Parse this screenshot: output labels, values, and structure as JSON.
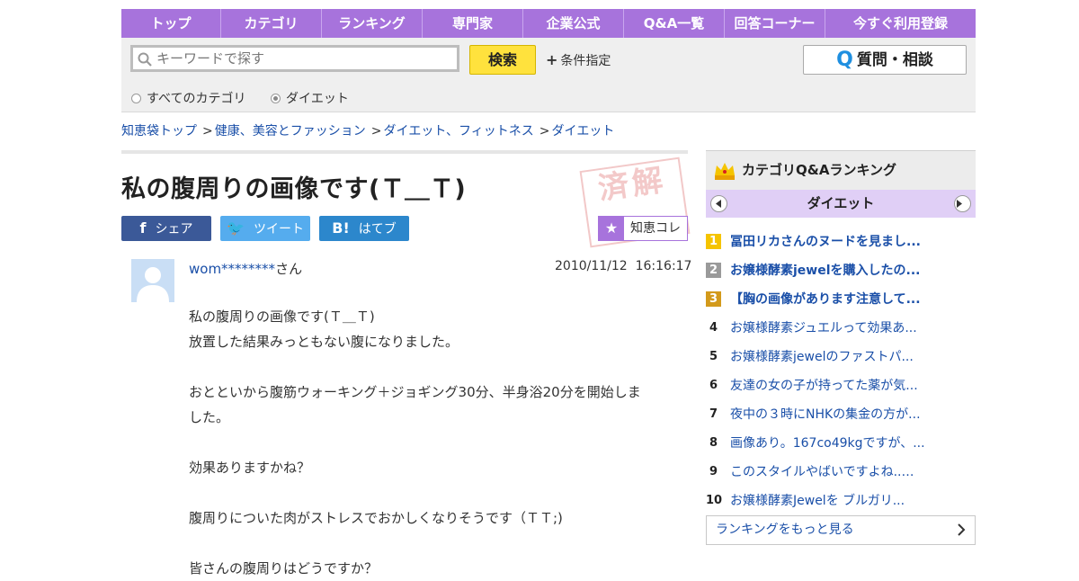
{
  "nav": [
    {
      "label": "トップ",
      "w": 111
    },
    {
      "label": "カテゴリ",
      "w": 112
    },
    {
      "label": "ランキング",
      "w": 112
    },
    {
      "label": "専門家",
      "w": 112
    },
    {
      "label": "企業公式",
      "w": 112
    },
    {
      "label": "Q&A一覧",
      "w": 112
    },
    {
      "label": "回答コーナー",
      "w": 112
    },
    {
      "label": "今すぐ利用登録",
      "w": 167
    }
  ],
  "search": {
    "placeholder": "キーワードで探す",
    "button_label": "検索",
    "condition_label": "条件指定",
    "ask_button_label": "質問・相談",
    "scope_all": "すべてのカテゴリ",
    "scope_current": "ダイエット"
  },
  "breadcrumb": [
    "知恵袋トップ",
    "健康、美容とファッション",
    "ダイエット、フィットネス",
    "ダイエット"
  ],
  "question": {
    "title": "私の腹周りの画像です(Ｔ＿Ｔ)",
    "stamp_text": "済解",
    "user": "wom********",
    "user_suffix": "さん",
    "date": "2010/11/12  16:16:17",
    "body": [
      "私の腹周りの画像です(Ｔ＿Ｔ)",
      "放置した結果みっともない腹になりました。",
      "",
      "おとといから腹筋ウォーキング＋ジョギング30分、半身浴20分を開始しま",
      "した。",
      "",
      "効果ありますかね？",
      "",
      "腹周りについた肉がストレスでおかしくなりそうです（ＴＴ;)",
      "",
      "皆さんの腹周りはどうですか？"
    ]
  },
  "share": {
    "facebook": "シェア",
    "twitter": "ツイート",
    "hatena": "はてブ",
    "chiekore": "知恵コレ"
  },
  "sidebar": {
    "title": "カテゴリQ&Aランキング",
    "category": "ダイエット",
    "ranking": [
      {
        "num": "1",
        "title": "冨田リカさんのヌードを見まし..."
      },
      {
        "num": "2",
        "title": "お嬢様酵素jewelを購入したの..."
      },
      {
        "num": "3",
        "title": "【胸の画像があります注意して..."
      },
      {
        "num": "4",
        "title": "お嬢様酵素ジュエルって効果あ..."
      },
      {
        "num": "5",
        "title": "お嬢様酵素jewelのファストパ..."
      },
      {
        "num": "6",
        "title": "友達の女の子が持ってた薬が気..."
      },
      {
        "num": "7",
        "title": "夜中の３時にNHKの集金の方が..."
      },
      {
        "num": "8",
        "title": "画像あり。167co49kgですが、..."
      },
      {
        "num": "9",
        "title": "このスタイルやばいですよね..…"
      },
      {
        "num": "10",
        "title": "お嬢様酵素Jewelを ブルガリ..."
      }
    ],
    "more_label": "ランキングをもっと見る"
  },
  "colors": {
    "nav_purple": "#a773dc",
    "search_yellow": "#ffe23d",
    "link_blue": "#1a4fa8",
    "facebook": "#3b5998",
    "twitter": "#55acee",
    "hatena": "#2c87cc"
  }
}
